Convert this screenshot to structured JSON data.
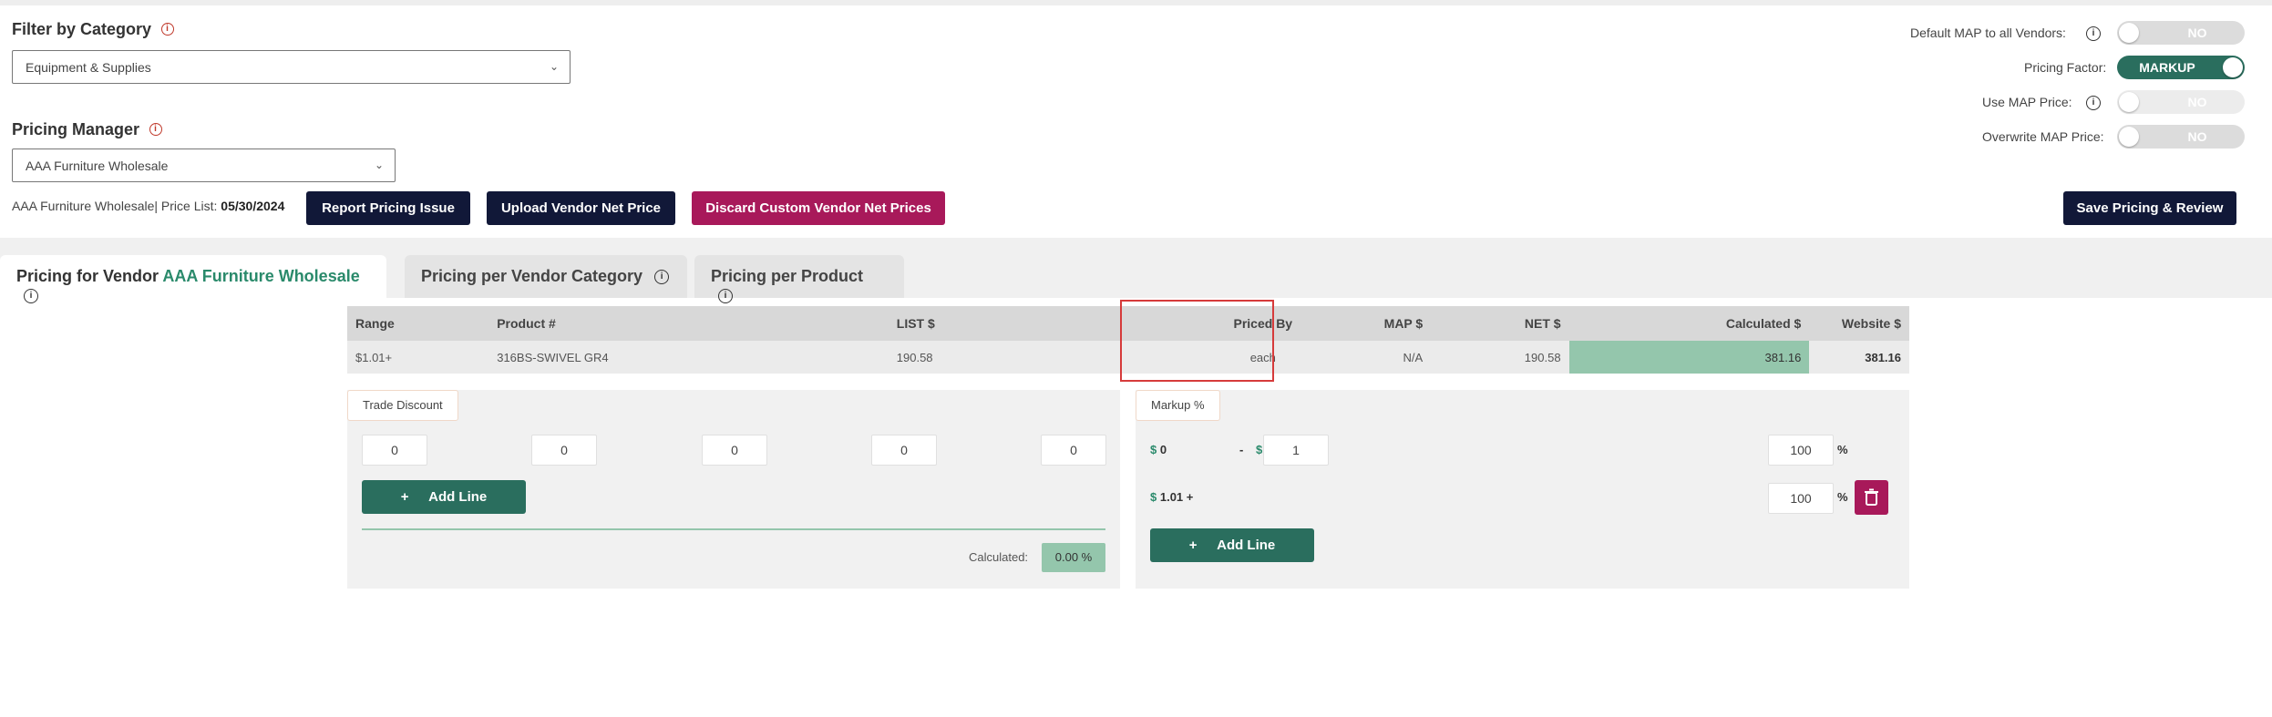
{
  "filter": {
    "title": "Filter by Category",
    "info": "i",
    "selected": "Equipment & Supplies"
  },
  "pricing_manager": {
    "title": "Pricing Manager",
    "info": "i",
    "selected": "AAA Furniture Wholesale"
  },
  "price_list": {
    "vendor_label": "AAA Furniture Wholesale| Price List:",
    "date": "05/30/2024"
  },
  "buttons": {
    "report": "Report Pricing Issue",
    "upload": "Upload Vendor Net Price",
    "discard": "Discard Custom Vendor Net Prices",
    "save": "Save Pricing & Review"
  },
  "toggles": {
    "default_map": {
      "label": "Default MAP to all Vendors:",
      "value": "NO"
    },
    "pricing_factor": {
      "label": "Pricing Factor:",
      "value": "MARKUP"
    },
    "use_map": {
      "label": "Use MAP Price:",
      "value": "NO"
    },
    "overwrite_map": {
      "label": "Overwrite MAP Price:",
      "value": "NO"
    }
  },
  "tabs": [
    {
      "prefix": "Pricing for Vendor",
      "vendor": "AAA Furniture Wholesale"
    },
    {
      "label": "Pricing per Vendor Category"
    },
    {
      "label": "Pricing per Product"
    }
  ],
  "table": {
    "headers": [
      "Range",
      "Product #",
      "LIST $",
      "Priced By",
      "MAP $",
      "NET $",
      "Calculated $",
      "Website $"
    ],
    "row": [
      "$1.01+",
      "316BS-SWIVEL GR4",
      "190.58",
      "each",
      "N/A",
      "190.58",
      "381.16",
      "381.16"
    ]
  },
  "trade_discount": {
    "tag": "Trade Discount",
    "values": [
      "0",
      "0",
      "0",
      "0",
      "0"
    ],
    "add_line": "Add Line",
    "calculated_label": "Calculated:",
    "calculated_value": "0.00 %"
  },
  "markup": {
    "tag": "Markup %",
    "row1": {
      "from_sign": "$",
      "from": "0",
      "dash": "-",
      "to_sign": "$",
      "to": "1",
      "pct": "100",
      "pct_sign": "%"
    },
    "row2": {
      "from_sign": "$",
      "from": "1.01 +",
      "pct": "100",
      "pct_sign": "%"
    },
    "add_line": "Add Line"
  },
  "colors": {
    "navy": "#111838",
    "pink": "#a8195a",
    "green": "#2a6e5e",
    "calc_green": "#94c6ac",
    "highlight": "#d63b3b"
  }
}
